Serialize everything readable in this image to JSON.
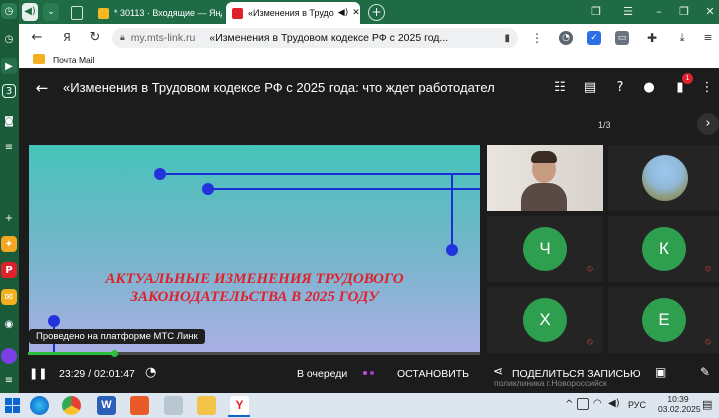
{
  "browser": {
    "tabs": [
      {
        "label": "* 30113 · Входящие — Янд"
      },
      {
        "label": "«Изменения в Трудо"
      }
    ],
    "new_tab_icon": "plus-icon",
    "address": {
      "domain": "my.mts-link.ru",
      "page_title": "«Изменения в Трудовом кодексе РФ с 2025 год..."
    },
    "bookmark": {
      "label": "Почта Mail"
    }
  },
  "webinar": {
    "title": "«Изменения в Трудовом кодексе РФ с 2025 года: что ждет работодател",
    "notification_count": "1",
    "page_indicator": "1/3",
    "slide": {
      "line1": "АКТУАЛЬНЫЕ ИЗМЕНЕНИЯ ТРУДОВОГО",
      "line2": "ЗАКОНОДАТЕЛЬСТВА В 2025 ГОДУ"
    },
    "participants": [
      {
        "initial": "Ч"
      },
      {
        "initial": "К"
      },
      {
        "initial": "Х"
      },
      {
        "initial": "Е"
      }
    ],
    "overlay_label": "Проведено на платформе МТС Линк",
    "bottom_caption": "поликлиника г.Новороссийск",
    "player": {
      "time": "23:29 / 02:01:47",
      "progress": 0.19,
      "queue_label": "В очереди",
      "stop_label": "ОСТАНОВИТЬ",
      "share_label": "ПОДЕЛИТЬСЯ ЗАПИСЬЮ"
    }
  },
  "taskbar": {
    "language": "РУС",
    "time": "10:39",
    "date": "03.02.2025"
  },
  "colors": {
    "browser_green": "#1f6b46",
    "avatar_green": "#2e9e4f",
    "slide_title_red": "#e0202a",
    "progress_green": "#2bbf3c",
    "taskbar_bg": "#dde6ee"
  }
}
